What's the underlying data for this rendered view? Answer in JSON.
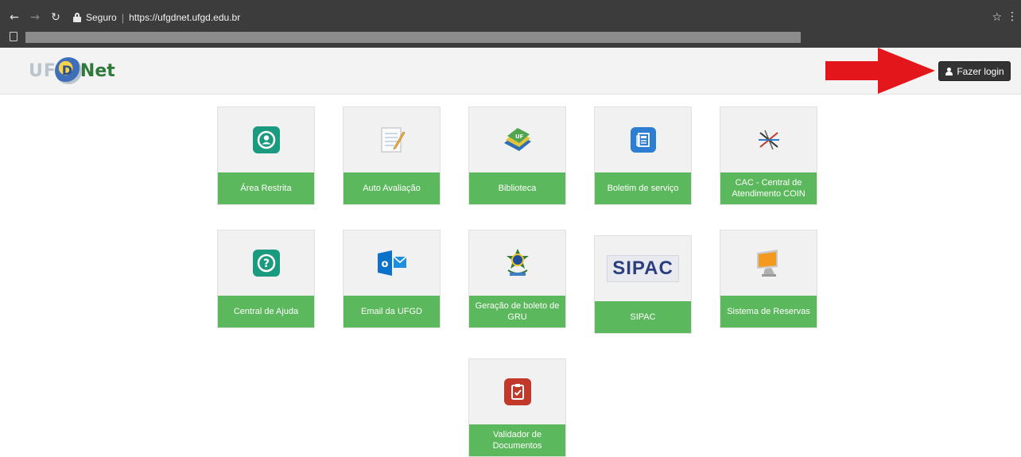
{
  "browser": {
    "secure_label": "Seguro",
    "url": "https://ufgdnet.ufgd.edu.br"
  },
  "header": {
    "logo_prefix": "UF",
    "logo_mid": "D",
    "logo_suffix": "Net",
    "login_label": "Fazer login"
  },
  "tiles": [
    {
      "label": "Área Restrita",
      "icon": "user-circle-icon"
    },
    {
      "label": "Auto Avaliação",
      "icon": "notepad-pencil-icon"
    },
    {
      "label": "Biblioteca",
      "icon": "books-icon"
    },
    {
      "label": "Boletim de serviço",
      "icon": "newspaper-icon"
    },
    {
      "label": "CAC - Central de Atendimento COIN",
      "icon": "coin-logo-icon"
    },
    {
      "label": "Central de Ajuda",
      "icon": "help-question-icon"
    },
    {
      "label": "Email da UFGD",
      "icon": "outlook-mail-icon"
    },
    {
      "label": "Geração de boleto de GRU",
      "icon": "brazil-coat-of-arms-icon"
    },
    {
      "label": "SIPAC",
      "icon": "sipac-logo-icon",
      "logo_text": "SIPAC"
    },
    {
      "label": "Sistema de Reservas",
      "icon": "computer-monitor-icon"
    },
    {
      "label": "Validador de Documentos",
      "icon": "clipboard-check-icon"
    }
  ],
  "colors": {
    "tile_label_bg": "#5cb85c",
    "teal_icon": "#1a9a7e",
    "blue_icon": "#2d7dd2",
    "red_icon": "#c0392b",
    "arrow": "#e3161b",
    "login_bg": "#333333"
  }
}
